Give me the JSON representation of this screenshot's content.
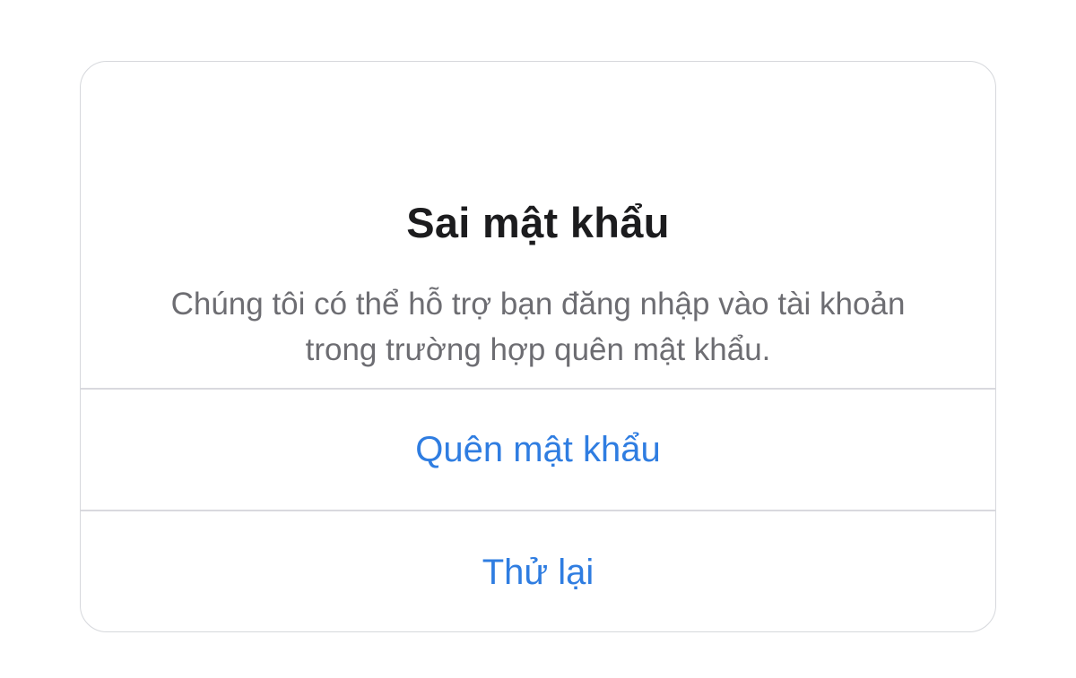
{
  "alert": {
    "title": "Sai mật khẩu",
    "message": "Chúng tôi có thể hỗ trợ bạn đăng nhập vào tài khoản trong trường hợp quên mật khẩu.",
    "actions": [
      {
        "label": "Quên mật khẩu"
      },
      {
        "label": "Thử lại"
      }
    ]
  },
  "colors": {
    "action_text": "#2f7de1",
    "title_text": "#1c1c1e",
    "message_text": "#6d6d72",
    "divider": "#d9d9de"
  }
}
